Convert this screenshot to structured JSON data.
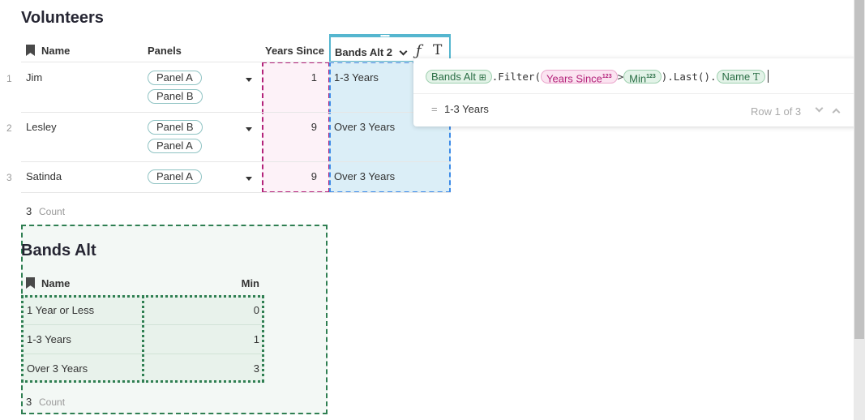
{
  "volunteers": {
    "title": "Volunteers",
    "columns": {
      "name": "Name",
      "panels": "Panels",
      "years_since": "Years Since",
      "bands_alt_2": "Bands Alt 2"
    },
    "rows": [
      {
        "num": "1",
        "name": "Jim",
        "panels": [
          "Panel A",
          "Panel B"
        ],
        "years_since": "1",
        "bands_alt_2": "1-3 Years"
      },
      {
        "num": "2",
        "name": "Lesley",
        "panels": [
          "Panel B",
          "Panel A"
        ],
        "years_since": "9",
        "bands_alt_2": "Over 3 Years"
      },
      {
        "num": "3",
        "name": "Satinda",
        "panels": [
          "Panel A"
        ],
        "years_since": "9",
        "bands_alt_2": "Over 3 Years"
      }
    ],
    "footer": {
      "count": "3",
      "label": "Count"
    }
  },
  "bands_alt": {
    "title": "Bands Alt",
    "columns": {
      "name": "Name",
      "min": "Min"
    },
    "rows": [
      {
        "name": "1 Year or Less",
        "min": "0"
      },
      {
        "name": "1-3 Years",
        "min": "1"
      },
      {
        "name": "Over 3 Years",
        "min": "3"
      }
    ],
    "footer": {
      "count": "3",
      "label": "Count"
    }
  },
  "formula_editor": {
    "token_table": "Bands Alt",
    "code_filter": ".Filter(",
    "token_years": "Years Since",
    "num_badge": "123",
    "code_gt": ">",
    "token_min": "Min",
    "code_last": ").Last().",
    "token_name": "Name",
    "text_badge": "T",
    "result_prefix": "=",
    "result_value": "1-3 Years",
    "row_indicator": "Row 1 of 3"
  },
  "column_menu_icons": [
    "chevron-down-icon",
    "formula-icon",
    "text-type-icon"
  ],
  "colors": {
    "accent_teal": "#55b6cf",
    "pink": "#b3227a",
    "blue": "#3d8be8",
    "green": "#2f7f52"
  }
}
